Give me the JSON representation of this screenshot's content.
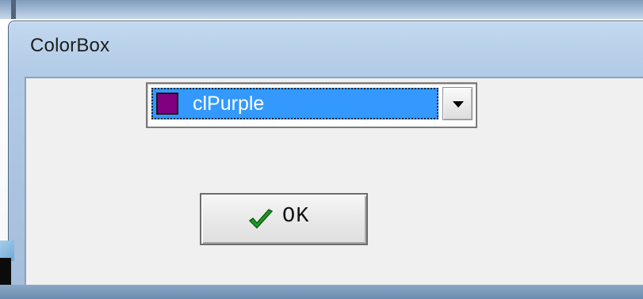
{
  "dialog": {
    "title": "ColorBox"
  },
  "color_box": {
    "selected_value": "clPurple",
    "swatch_color": "#800080",
    "highlight_color": "#3399ff"
  },
  "buttons": {
    "ok_label": "OK"
  },
  "icons": {
    "ok_icon": "checkmark-icon",
    "dropdown_icon": "chevron-down-icon"
  }
}
